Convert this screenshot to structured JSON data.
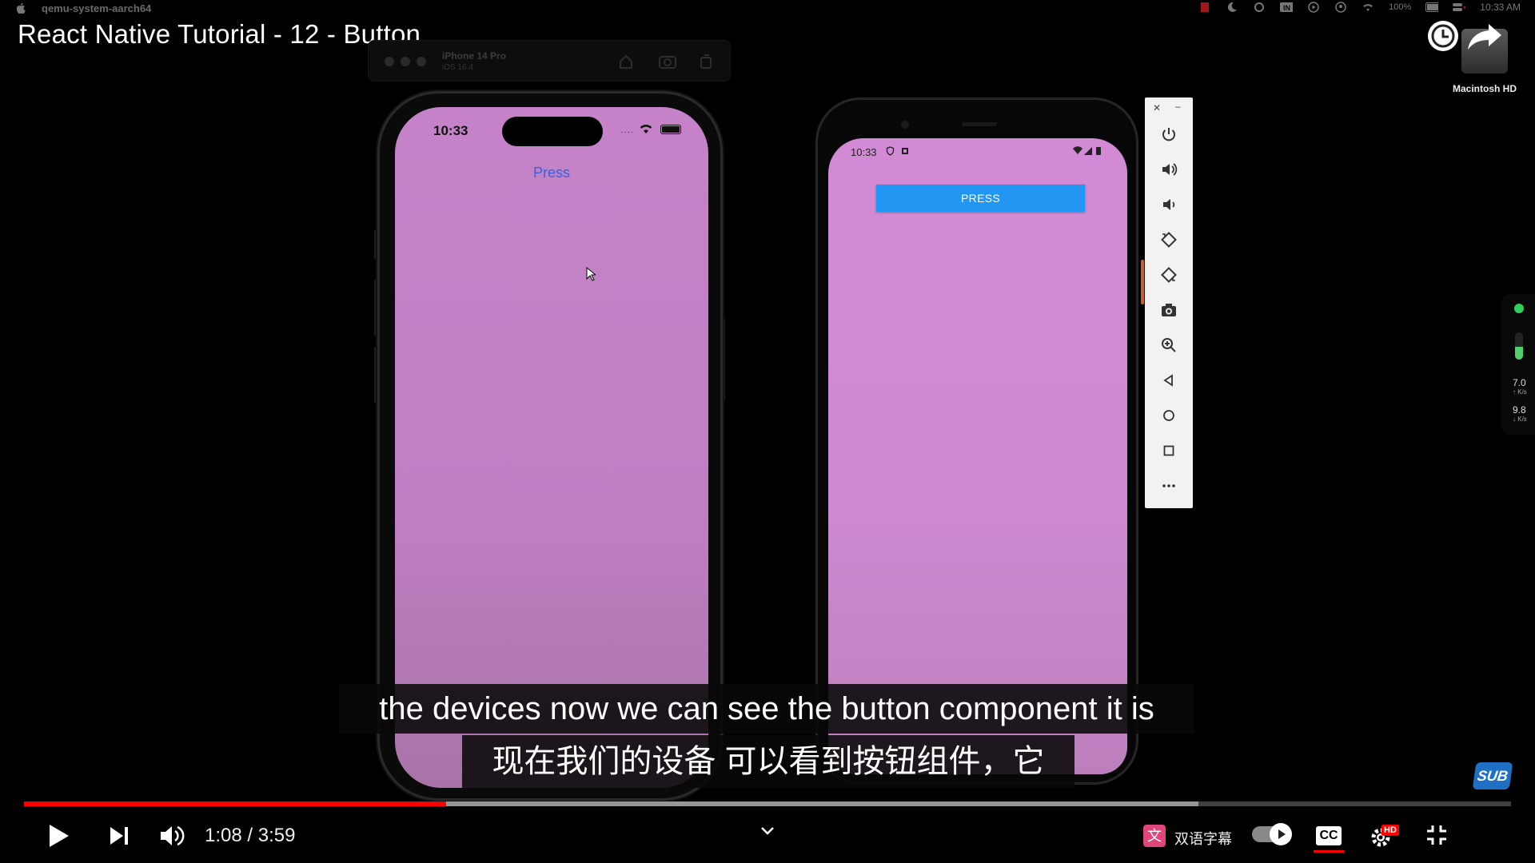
{
  "menubar": {
    "app_name": "qemu-system-aarch64",
    "battery": "100%",
    "clock": "10:33 AM"
  },
  "video": {
    "title": "React Native Tutorial - 12 - Button",
    "time": "1:08 / 3:59",
    "progress_played": 0.284,
    "progress_loaded": 0.79
  },
  "desktop": {
    "disk_label": "Macintosh HD"
  },
  "ios_sim": {
    "device_name": "iPhone 14 Pro",
    "os": "iOS 16.4",
    "status_time": "10:33",
    "button_label": "Press"
  },
  "android_emu": {
    "status_time": "10:33",
    "button_label": "PRESS"
  },
  "network": {
    "up": "7.0",
    "down": "9.8",
    "unit": "K/s"
  },
  "subtitles": {
    "line_en": "the devices now we can see the button component it is",
    "line_zh": "现在我们的设备 可以看到按钮组件，它"
  },
  "controls": {
    "translate_label": "双语字幕",
    "cc_label": "CC",
    "hd_label": "HD",
    "sub_logo": "SUB"
  },
  "colors": {
    "ios_bg": "#c582c8",
    "android_bg": "#d28ad4",
    "android_button": "#2196f3",
    "progress": "#ff0000"
  }
}
